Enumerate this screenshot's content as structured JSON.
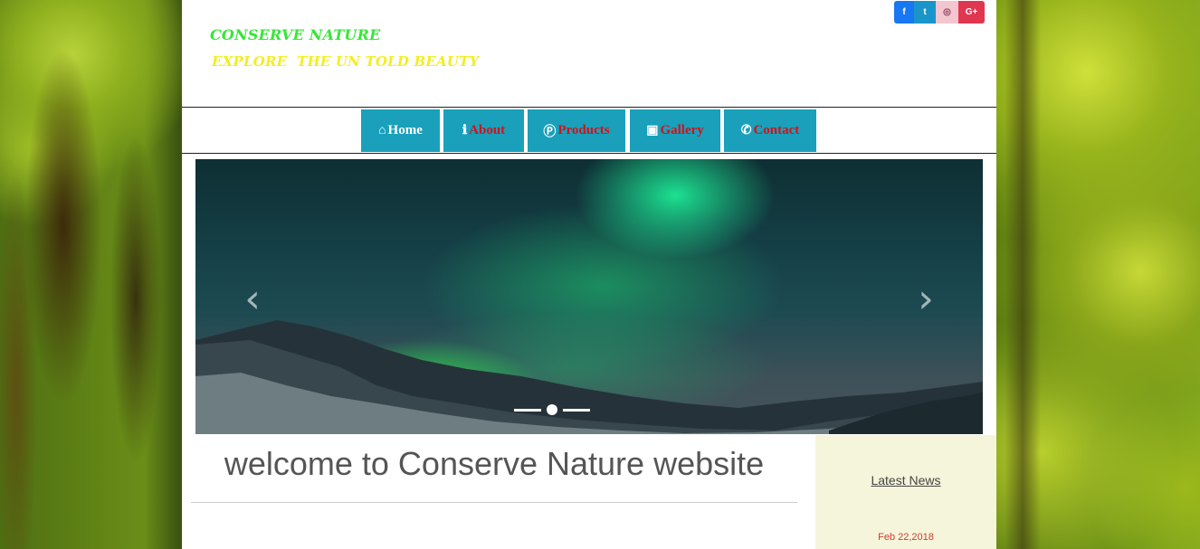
{
  "header": {
    "title": "CONSERVE NATURE",
    "subtitle": "EXPLORE  THE UN TOLD BEAUTY",
    "title_color": "#37e637",
    "subtitle_color": "#f2ee22"
  },
  "social": [
    {
      "name": "facebook",
      "glyph": "f",
      "color": "#1877f2"
    },
    {
      "name": "twitter",
      "glyph": "t",
      "color": "#1a95c9"
    },
    {
      "name": "instagram",
      "glyph": "◎",
      "color": "#f3c6d0"
    },
    {
      "name": "google-plus",
      "glyph": "G+",
      "color": "#e0364f"
    }
  ],
  "nav": {
    "accent": "#1aa0bb",
    "items": [
      {
        "label": "Home",
        "icon": "home-icon",
        "glyph": "⌂"
      },
      {
        "label": "About",
        "icon": "info-icon",
        "glyph": "ℹ"
      },
      {
        "label": "Products",
        "icon": "product-icon",
        "glyph": "Ⓟ"
      },
      {
        "label": "Gallery",
        "icon": "image-icon",
        "glyph": "▣"
      },
      {
        "label": "Contact",
        "icon": "contact-icon",
        "glyph": "✆"
      }
    ]
  },
  "carousel": {
    "prev_glyph": "‹",
    "next_glyph": "›",
    "active_index": 1,
    "slide_count": 3
  },
  "main": {
    "welcome": "welcome to Conserve Nature website"
  },
  "news": {
    "title": "Latest News",
    "date": "Feb 22,2018"
  }
}
